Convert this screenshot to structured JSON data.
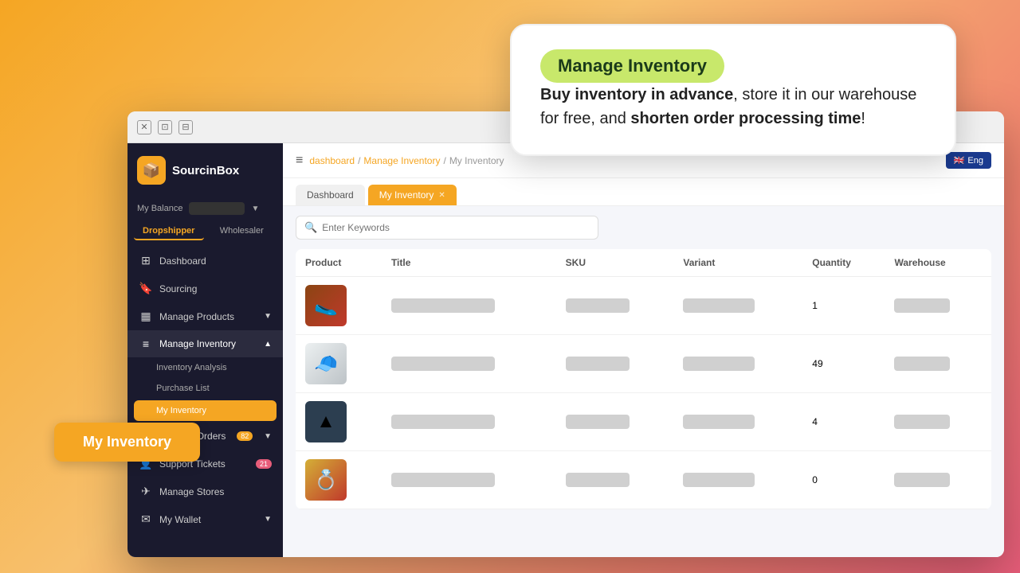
{
  "background": {
    "gradient": "linear-gradient(135deg, #f5a623 0%, #f7c06e 40%, #f0826e 75%, #e85d7a 100%)"
  },
  "window": {
    "title_bar_buttons": [
      "×",
      "⊡",
      "⊟"
    ]
  },
  "sidebar": {
    "logo_text": "SourcinBox",
    "balance_label": "My Balance",
    "tab_dropshipper": "Dropshipper",
    "tab_wholesaler": "Wholesaler",
    "nav_items": [
      {
        "id": "dashboard",
        "icon": "⊞",
        "label": "Dashboard"
      },
      {
        "id": "sourcing",
        "icon": "🔖",
        "label": "Sourcing"
      },
      {
        "id": "manage-products",
        "icon": "⊟",
        "label": "Manage Products",
        "has_arrow": true
      },
      {
        "id": "manage-inventory",
        "icon": "≡",
        "label": "Manage Inventory",
        "has_arrow_up": true,
        "active": true
      },
      {
        "id": "inventory-analysis",
        "icon": "",
        "label": "Inventory Analysis",
        "sub": true
      },
      {
        "id": "purchase-list",
        "icon": "",
        "label": "Purchase List",
        "sub": true
      },
      {
        "id": "my-inventory",
        "icon": "",
        "label": "My Inventory",
        "sub": true,
        "highlighted": true
      },
      {
        "id": "manage-orders",
        "icon": "≡",
        "label": "Manage Orders",
        "badge": "82",
        "has_arrow": true
      },
      {
        "id": "support-tickets",
        "icon": "👤",
        "label": "Support Tickets",
        "badge": "21",
        "badge_color": "red"
      },
      {
        "id": "manage-stores",
        "icon": "✈",
        "label": "Manage Stores"
      },
      {
        "id": "my-wallet",
        "icon": "✉",
        "label": "My Wallet",
        "has_arrow": true
      }
    ]
  },
  "topbar": {
    "menu_icon": "≡",
    "breadcrumb": [
      "dashboard",
      "Manage Inventory",
      "My Inventory"
    ],
    "lang_flag": "🇬🇧",
    "lang_text": "Eng"
  },
  "tabs": [
    {
      "id": "dashboard-tab",
      "label": "Dashboard",
      "active": false
    },
    {
      "id": "my-inventory-tab",
      "label": "My Inventory",
      "active": true,
      "closable": true
    }
  ],
  "search": {
    "placeholder": "Enter Keywords"
  },
  "table": {
    "headers": [
      "Product",
      "Title",
      "SKU",
      "Variant",
      "Quantity",
      "Warehouse"
    ],
    "rows": [
      {
        "id": 1,
        "qty": "1",
        "img_emoji": "🥿"
      },
      {
        "id": 2,
        "qty": "49",
        "img_emoji": "🧢"
      },
      {
        "id": 3,
        "qty": "4",
        "img_emoji": "🌑"
      },
      {
        "id": 4,
        "qty": "0",
        "img_emoji": "💍"
      }
    ]
  },
  "tooltip": {
    "tag_text": "Manage Inventory",
    "headline_bold": "Buy inventory in advance",
    "headline_rest": ", store it in our warehouse for free,  and ",
    "highlight_bold": "shorten order processing time",
    "ending": "!"
  },
  "my_inventory_button": {
    "label": "My Inventory"
  }
}
